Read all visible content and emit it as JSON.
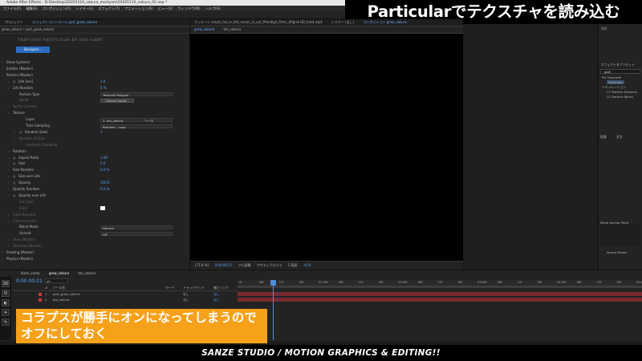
{
  "window": {
    "title": "Adobe After Effects - D:\\Desktop\\20201110_sakura_mortyam\\20201110_sakura_02.aep *"
  },
  "menu": [
    "ファイル(F)",
    "編集(E)",
    "コンポジション(C)",
    "レイヤー(L)",
    "エフェクト(T)",
    "アニメーション(A)",
    "ビュー(V)",
    "ウィンドウ(W)",
    "ヘルプ(H)"
  ],
  "headline": "Particularでテクスチャを読み込む",
  "effect_controls": {
    "tabs": [
      "プロジェクト",
      "エフェクトコントロール part_grow_sakura"
    ],
    "subtitle": "grow_sakura • part_grow_sakura",
    "plugin_header": "TRAPCODE PARTICULAR BY RED GIANT",
    "designer_button": "Designer...",
    "rows": [
      {
        "label": "Show Systems",
        "arrow": "›",
        "indent": 8
      },
      {
        "label": "Emitter (Master)",
        "arrow": "›",
        "indent": 8
      },
      {
        "label": "Particle (Master)",
        "arrow": "⌄",
        "indent": 8
      },
      {
        "label": "Life [sec]",
        "arrow": "›",
        "indent": 16,
        "stopwatch": true,
        "value": "1.0"
      },
      {
        "label": "Life Random",
        "arrow": "›",
        "indent": 16,
        "value": "0 %"
      },
      {
        "label": "Particle Type",
        "indent": 24,
        "dropdown": "Textured Polygon"
      },
      {
        "label": "Sprite",
        "indent": 24,
        "button": "Choose Sprite...",
        "dim": true
      },
      {
        "label": "Sprite Controls",
        "arrow": "›",
        "indent": 16,
        "dim": true
      },
      {
        "label": "Texture",
        "arrow": "⌄",
        "indent": 16
      },
      {
        "label": "Layer",
        "indent": 32,
        "dropdown": "2. tex_sakura",
        "dropdown2": "ソース"
      },
      {
        "label": "Time Sampling",
        "indent": 32,
        "dropdown": "Random - Loop"
      },
      {
        "label": "Random Seed",
        "arrow": "›",
        "indent": 24,
        "stopwatch": true,
        "value": "1"
      },
      {
        "label": "Number of Clips",
        "arrow": "›",
        "indent": 24,
        "dim": true
      },
      {
        "label": "Subframe Sampling",
        "indent": 32,
        "dim": true
      },
      {
        "label": "Rotation",
        "arrow": "›",
        "indent": 16
      },
      {
        "label": "Aspect Ratio",
        "arrow": "›",
        "indent": 16,
        "stopwatch": true,
        "value": "1.00"
      },
      {
        "label": "Size",
        "arrow": "›",
        "indent": 16,
        "stopwatch": true,
        "value": "5.0"
      },
      {
        "label": "Size Random",
        "arrow": "›",
        "indent": 16,
        "value": "0.0 %"
      },
      {
        "label": "Size over Life",
        "arrow": "›",
        "indent": 16,
        "stopwatch": true
      },
      {
        "label": "Opacity",
        "arrow": "›",
        "indent": 16,
        "stopwatch": true,
        "value": "100.0"
      },
      {
        "label": "Opacity Random",
        "arrow": "›",
        "indent": 16,
        "value": "0.0 %"
      },
      {
        "label": "Opacity over Life",
        "arrow": "›",
        "indent": 16,
        "stopwatch": true
      },
      {
        "label": "Set Color",
        "indent": 24,
        "dim": true
      },
      {
        "label": "Color",
        "indent": 24,
        "dim": true,
        "swatch": true
      },
      {
        "label": "Color Random",
        "arrow": "›",
        "indent": 16,
        "dim": true
      },
      {
        "label": "Color over Life",
        "arrow": "›",
        "indent": 16,
        "dim": true
      },
      {
        "label": "Blend Mode",
        "indent": 24,
        "dropdown": "Normal"
      },
      {
        "label": "Unmult",
        "indent": 24,
        "dropdown": "Off"
      },
      {
        "label": "Glow (Master)",
        "arrow": "›",
        "indent": 16,
        "dim": true
      },
      {
        "label": "Streaklet (Master)",
        "arrow": "›",
        "indent": 16,
        "dim": true
      },
      {
        "label": "Shading (Master)",
        "arrow": "›",
        "indent": 8
      },
      {
        "label": "Physics (Master)",
        "arrow": "›",
        "indent": 8
      }
    ]
  },
  "composition": {
    "tabs": [
      "フッテージ cloud_rise_in_the_ocean_in_out_Pfandige_Films_Alfgnd-HD_hsk4.mp4",
      "レイヤー (なし)",
      "コンポジション grow_sakura"
    ],
    "subtabs": [
      "grow_sakura",
      "tex_sakura"
    ],
    "footer": [
      "(71.8 %)",
      "0:00:00:21",
      "フル画質",
      "アクティブカメラ",
      "1 画面",
      "+0.0"
    ]
  },
  "right_panel": {
    "info_label": "情報",
    "effects_label": "エフェクト＆プリセット",
    "search_value": "part",
    "tree": [
      "RG Trapcode",
      "Particular",
      "シミュレーション",
      "CC Particle Systems",
      "CC Particle World"
    ],
    "paragraph_tabs": [
      "段落",
      "文字"
    ],
    "align_label": "Move Anchor Point",
    "ignore_masks": "Ignore Masks"
  },
  "timeline": {
    "tabs": [
      "black_comp",
      "grow_sakura",
      "tex_sakura"
    ],
    "timecode": "0:00:00:21",
    "search_placeholder": "ρ▾",
    "header": {
      "num": "#",
      "name": "ソース名",
      "mode": "モード",
      "trkmat": "トラックマット",
      "parent": "親とリンク"
    },
    "layers": [
      {
        "num": "1",
        "name": "part_grow_sakura",
        "mode": "",
        "trkmat": "なし",
        "parent": "なし",
        "color": "#c8393f"
      },
      {
        "num": "2",
        "name": "tex_sakura",
        "mode": "",
        "trkmat": "なし",
        "parent": "なし",
        "color": "#c8393f"
      }
    ],
    "ruler_ticks": [
      "0f",
      "06f",
      "12f",
      "18f",
      "01:00f",
      "06f",
      "12f",
      "18f",
      "02:00f",
      "06f",
      "12f",
      "18f",
      "03:00f",
      "06f",
      "12f",
      "18f",
      "04:00f",
      "06f",
      "12f",
      "18f",
      "05:00f"
    ]
  },
  "caption": {
    "line1": "コラプスが勝手にオンになってしまうので",
    "line2": "オフにしておく"
  },
  "footer": "SANZE STUDIO  / MOTION GRAPHICS & EDITING!!",
  "colors": {
    "accent_blue": "#5aa7ff",
    "caption_orange": "#f5a11a",
    "layer_bar": "#7a2a2d"
  }
}
